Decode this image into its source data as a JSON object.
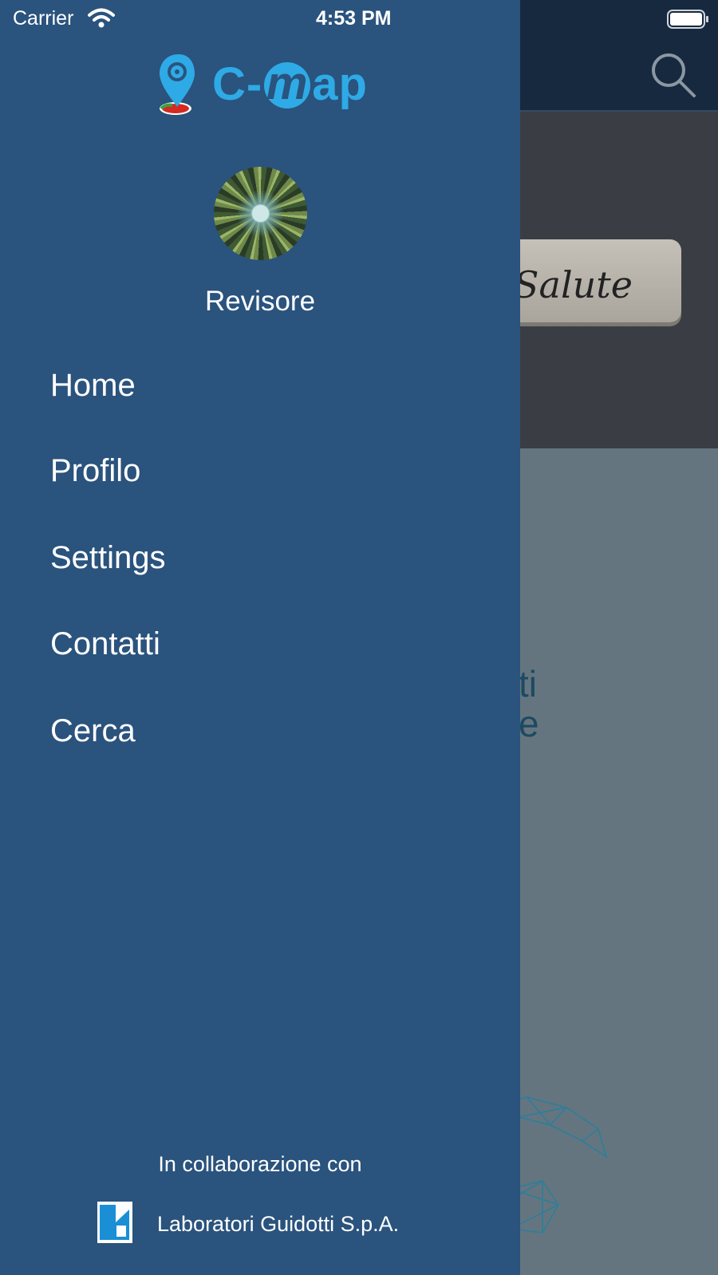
{
  "status_bar": {
    "carrier": "Carrier",
    "time": "4:53 PM",
    "wifi_icon": "wifi-icon",
    "battery_icon": "battery-icon"
  },
  "drawer": {
    "logo_text_prefix": "C-",
    "logo_text_m": "m",
    "logo_text_suffix": "ap",
    "user": {
      "name": "Revisore",
      "avatar": "forest-canopy-avatar"
    },
    "menu": [
      {
        "label": "Home"
      },
      {
        "label": "Profilo"
      },
      {
        "label": "Settings"
      },
      {
        "label": "Contatti"
      },
      {
        "label": "Cerca"
      }
    ],
    "footer": {
      "collab_text": "In collaborazione con",
      "partner_name": "Laboratori Guidotti S.p.A."
    }
  },
  "background": {
    "banner_text": "Salute",
    "partial_text": "ti\ne",
    "search_icon": "search-icon"
  },
  "colors": {
    "drawer_bg": "#2a537d",
    "navbar_bg": "#17293f",
    "logo_blue": "#2eaae6",
    "overlay_body": "#65757f"
  }
}
